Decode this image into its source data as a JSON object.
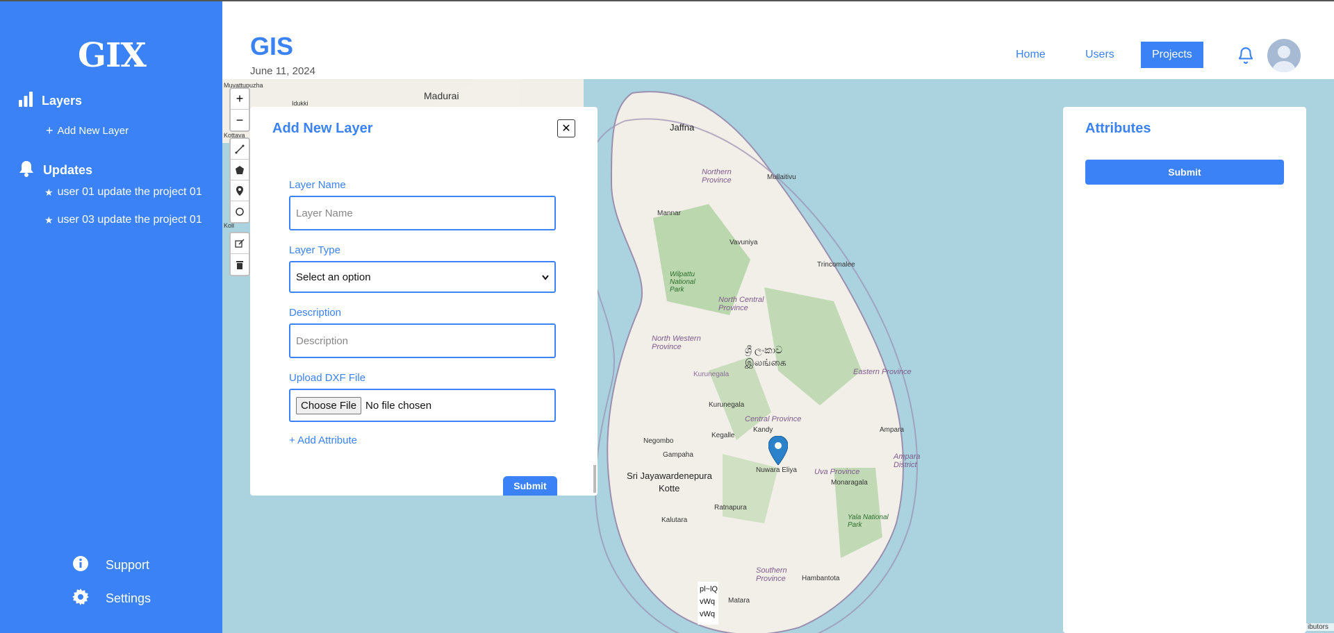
{
  "app": {
    "logo_text": "GIX",
    "title": "GIS",
    "date": "June 11, 2024",
    "accent_color": "#3b82f6"
  },
  "sidebar": {
    "layers_label": "Layers",
    "add_layer_label": "Add New Layer",
    "updates_label": "Updates",
    "updates": [
      "user 01 update the project 01",
      "user 03 update the project 01"
    ],
    "support_label": "Support",
    "settings_label": "Settings"
  },
  "nav": {
    "home": "Home",
    "users": "Users",
    "projects": "Projects",
    "active": "Projects"
  },
  "map": {
    "labels": {
      "madurai": "Madurai",
      "idukki": "Idukki",
      "muvattupuzha": "Muvattupuzha",
      "kottayam": "Kottaya",
      "kollam": "Koll",
      "jaffna": "Jaffna",
      "northern_province": "Northern Province",
      "mullaitivu": "Mullaitivu",
      "mannar": "Mannar",
      "vavuniya": "Vavuniya",
      "trincomalee": "Trincomalee",
      "wilpattu": "Wilpattu National Park",
      "north_central": "North Central Province",
      "north_western": "North Western Province",
      "sri_lanka_si": "ශ්‍රී ලංකාව",
      "sri_lanka_ta": "இலங்கை",
      "eastern_province": "Eastern Province",
      "kurunegala_a": "Kurunegala",
      "kurunegala_b": "Kurunegala",
      "central_province": "Central Province",
      "kandy": "Kandy",
      "kegalle": "Kegalle",
      "negombo": "Negombo",
      "gampaha": "Gampaha",
      "nuwara_eliya": "Nuwara Eliya",
      "uva_province": "Uva Province",
      "ampara": "Ampara",
      "ampara_district": "Ampara District",
      "sri_jayawardenepura": "Sri Jayawardenepura",
      "kotte": "Kotte",
      "monaragala": "Monaragala",
      "ratnapura": "Ratnapura",
      "kalutara": "Kalutara",
      "yala": "Yala National Park",
      "southern_province": "Southern Province",
      "hambantota": "Hambantota",
      "matara": "Matara"
    },
    "zoom_in": "+",
    "zoom_out": "−",
    "attribution": "ibutors",
    "glitch_lines": [
      "pl~lQ",
      "vWq",
      "vWq"
    ],
    "land_color": "#f2efe9",
    "water_color": "#aad3df"
  },
  "modal": {
    "title": "Add New Layer",
    "close_label": "✕",
    "layer_name_label": "Layer Name",
    "layer_name_placeholder": "Layer Name",
    "layer_type_label": "Layer Type",
    "layer_type_value": "Select an option",
    "description_label": "Description",
    "description_placeholder": "Description",
    "upload_label": "Upload DXF File",
    "choose_file": "Choose File",
    "no_file": "No file chosen",
    "add_attribute": "+ Add Attribute",
    "submit": "Submit"
  },
  "attributes": {
    "title": "Attributes",
    "submit": "Submit"
  }
}
